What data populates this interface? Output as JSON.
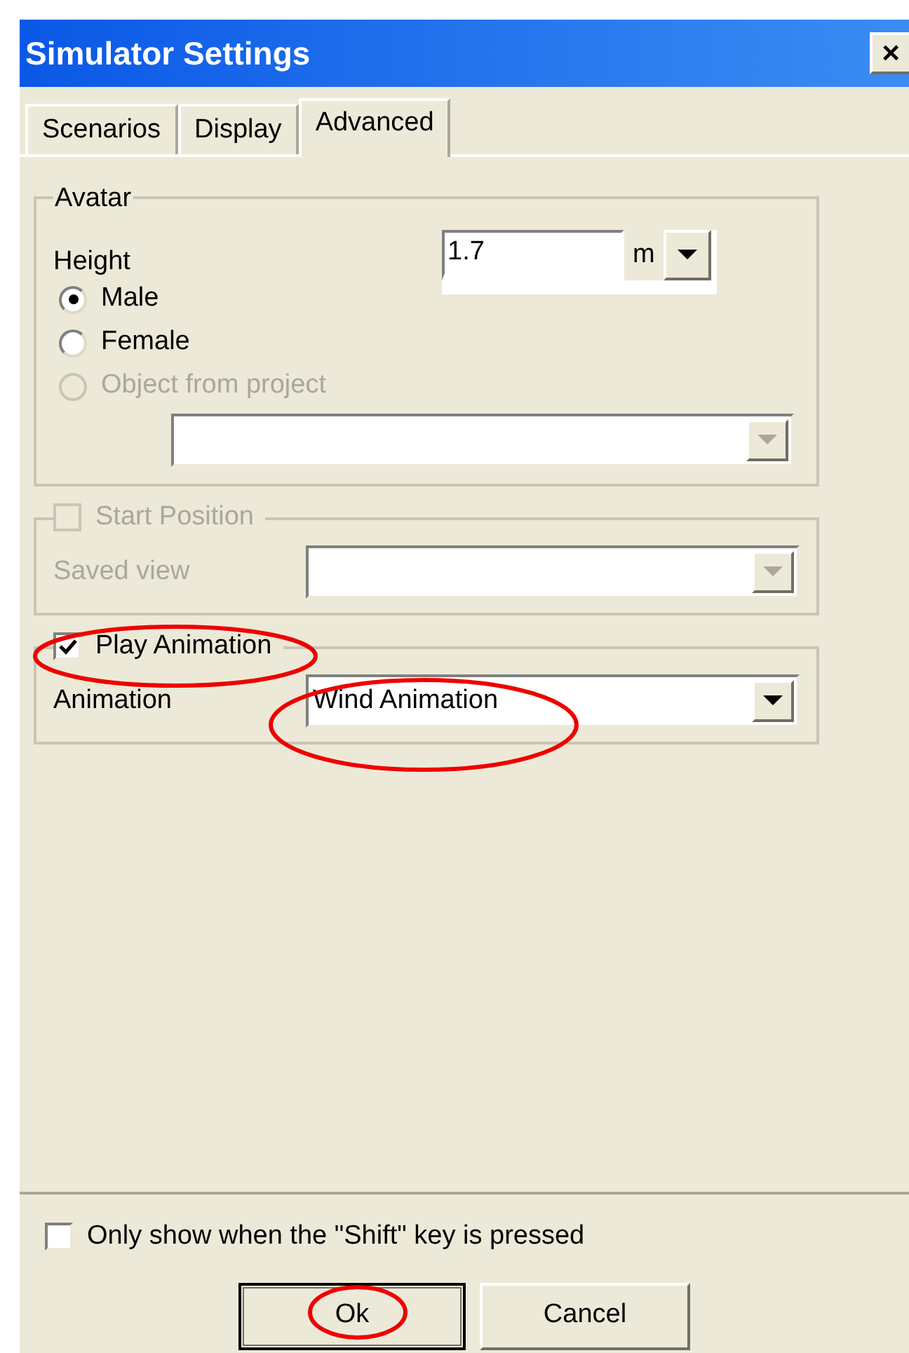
{
  "window": {
    "title": "Simulator Settings",
    "close": "×"
  },
  "tabs": [
    {
      "label": "Scenarios",
      "selected": false
    },
    {
      "label": "Display",
      "selected": false
    },
    {
      "label": "Advanced",
      "selected": true
    }
  ],
  "avatar": {
    "title": "Avatar",
    "height_label": "Height",
    "height_value": "1.7",
    "unit": "m",
    "radios": [
      {
        "label": "Male",
        "selected": true,
        "disabled": false
      },
      {
        "label": "Female",
        "selected": false,
        "disabled": false
      },
      {
        "label": "Object from project",
        "selected": false,
        "disabled": true
      }
    ],
    "object_dropdown": {
      "disabled": true
    }
  },
  "start_position": {
    "label": "Start Position",
    "checked": false,
    "disabled": true,
    "saved_view_label": "Saved view"
  },
  "play_animation": {
    "label": "Play Animation",
    "checked": true,
    "disabled": false,
    "animation_label": "Animation",
    "animation_value": "Wind Animation"
  },
  "shift_checkbox": {
    "label": "Only show when the \"Shift\" key is pressed",
    "checked": false
  },
  "buttons": [
    {
      "label": "Ok",
      "default": true
    },
    {
      "label": "Cancel",
      "default": false
    }
  ]
}
